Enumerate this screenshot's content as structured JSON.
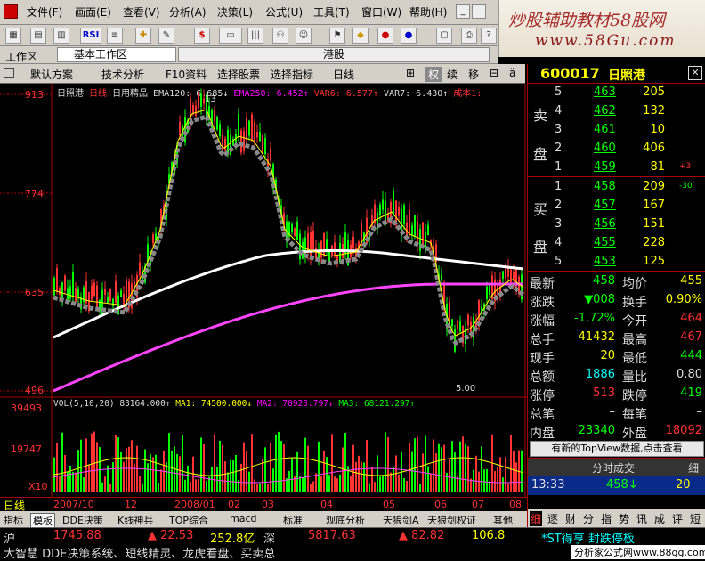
{
  "menus": [
    "文件(F)",
    "画面(E)",
    "查看(V)",
    "分析(A)",
    "决策(L)",
    "公式(U)",
    "工具(T)",
    "窗口(W)",
    "帮助(H)"
  ],
  "banner": {
    "line1": "炒股辅助教材58股网",
    "line2": "www.58Gu.com"
  },
  "workbar": {
    "label": "工作区",
    "dropdown": "基本工作区",
    "title": "港股"
  },
  "tabs": [
    "默认方案",
    "技术分析",
    "F10资料",
    "选择股票",
    "选择指标",
    "日线"
  ],
  "tab_icons": [
    "⊞",
    "权",
    "续",
    "移",
    "⊟"
  ],
  "stock": {
    "code": "600017",
    "name": "日照港"
  },
  "chart_header": {
    "name": "日照港",
    "period": "日线",
    "indicator": "日用精品",
    "ema120": "EMA120: 6.685↓",
    "ema250": "EMA250: 6.452↑",
    "var6": "VAR6: 6.577↑",
    "var7": "VAR7: 6.430↑",
    "extra": "成本1:"
  },
  "price_axis": [
    "913",
    "774",
    "635",
    "496"
  ],
  "price_annot": {
    "high": "13",
    "low": "5.00"
  },
  "vol_header": {
    "vol": "VOL(5,10,20) 83164.000↑",
    "ma1": "MA1: 74500.000↓",
    "ma2": "MA2: 70923.797↓",
    "ma3": "MA3: 68121.297↑"
  },
  "vol_axis": [
    "39493",
    "19747",
    "X10"
  ],
  "x_axis": [
    "日线",
    "2007/10",
    "12",
    "2008/01",
    "02",
    "03",
    "04",
    "05",
    "06",
    "07",
    "08"
  ],
  "bottom_tabs": [
    "指标",
    "模板",
    "DDE决策",
    "K线神兵",
    "TOP综合",
    "macd",
    "标准",
    "观底分析",
    "天狼剑A",
    "天狼剑权证",
    "其他"
  ],
  "right_tabs": [
    "细",
    "逐",
    "财",
    "分",
    "指",
    "势",
    "讯",
    "成",
    "评",
    "短"
  ],
  "sell": [
    {
      "lvl": "5",
      "price": "463",
      "vol": "205",
      "chg": ""
    },
    {
      "lvl": "4",
      "price": "462",
      "vol": "132",
      "chg": ""
    },
    {
      "lvl": "3",
      "price": "461",
      "vol": "10",
      "chg": ""
    },
    {
      "lvl": "2",
      "price": "460",
      "vol": "406",
      "chg": ""
    },
    {
      "lvl": "1",
      "price": "459",
      "vol": "81",
      "chg": "+3"
    }
  ],
  "buy": [
    {
      "lvl": "1",
      "price": "458",
      "vol": "209",
      "chg": "-30"
    },
    {
      "lvl": "2",
      "price": "457",
      "vol": "167",
      "chg": ""
    },
    {
      "lvl": "3",
      "price": "456",
      "vol": "151",
      "chg": ""
    },
    {
      "lvl": "4",
      "price": "455",
      "vol": "228",
      "chg": ""
    },
    {
      "lvl": "5",
      "price": "453",
      "vol": "125",
      "chg": ""
    }
  ],
  "sell_label": [
    "卖",
    "盘"
  ],
  "buy_label": [
    "买",
    "盘"
  ],
  "quote": [
    {
      "l1": "最新",
      "v1": "458",
      "l2": "均价",
      "v2": "455"
    },
    {
      "l1": "涨跌",
      "v1": "▼008",
      "l2": "换手",
      "v2": "0.90%"
    },
    {
      "l1": "涨幅",
      "v1": "-1.72%",
      "l2": "今开",
      "v2": "464"
    },
    {
      "l1": "总手",
      "v1": "41432",
      "l2": "最高",
      "v2": "467"
    },
    {
      "l1": "现手",
      "v1": "20",
      "l2": "最低",
      "v2": "444"
    },
    {
      "l1": "总额",
      "v1": "1886",
      "l2": "量比",
      "v2": "0.80"
    },
    {
      "l1": "涨停",
      "v1": "513",
      "l2": "跌停",
      "v2": "419"
    },
    {
      "l1": "总笔",
      "v1": "–",
      "l2": "每笔",
      "v2": "–"
    },
    {
      "l1": "内盘",
      "v1": "23340",
      "l2": "外盘",
      "v2": "18092"
    }
  ],
  "topview": "有新的TopView数据,点击查看",
  "trades_title": "分时成交",
  "trade": {
    "time": "13:33",
    "price": "458↓",
    "vol": "20"
  },
  "status": {
    "sh": "沪",
    "sh_val": "1745.88",
    "sh_chg": "▲ 22.53",
    "sh_amt": "252.8亿",
    "sz": "深",
    "sz_val": "5817.63",
    "sz_chg": "▲ 82.82",
    "sz_pct": "106.8",
    "news": "*ST得亨 封跌停板",
    "line2": "大智慧 DDE决策系统、短线精灵、龙虎看盘、买卖总",
    "site": "分析家公式网www.88gg.com"
  },
  "colors": {
    "up": "#ff3333",
    "down": "#00ff00",
    "ema120": "#ffffff",
    "ema250": "#ff44ff",
    "blue": "#2233ff",
    "gray": "#888888",
    "yellow": "#ffff00"
  }
}
